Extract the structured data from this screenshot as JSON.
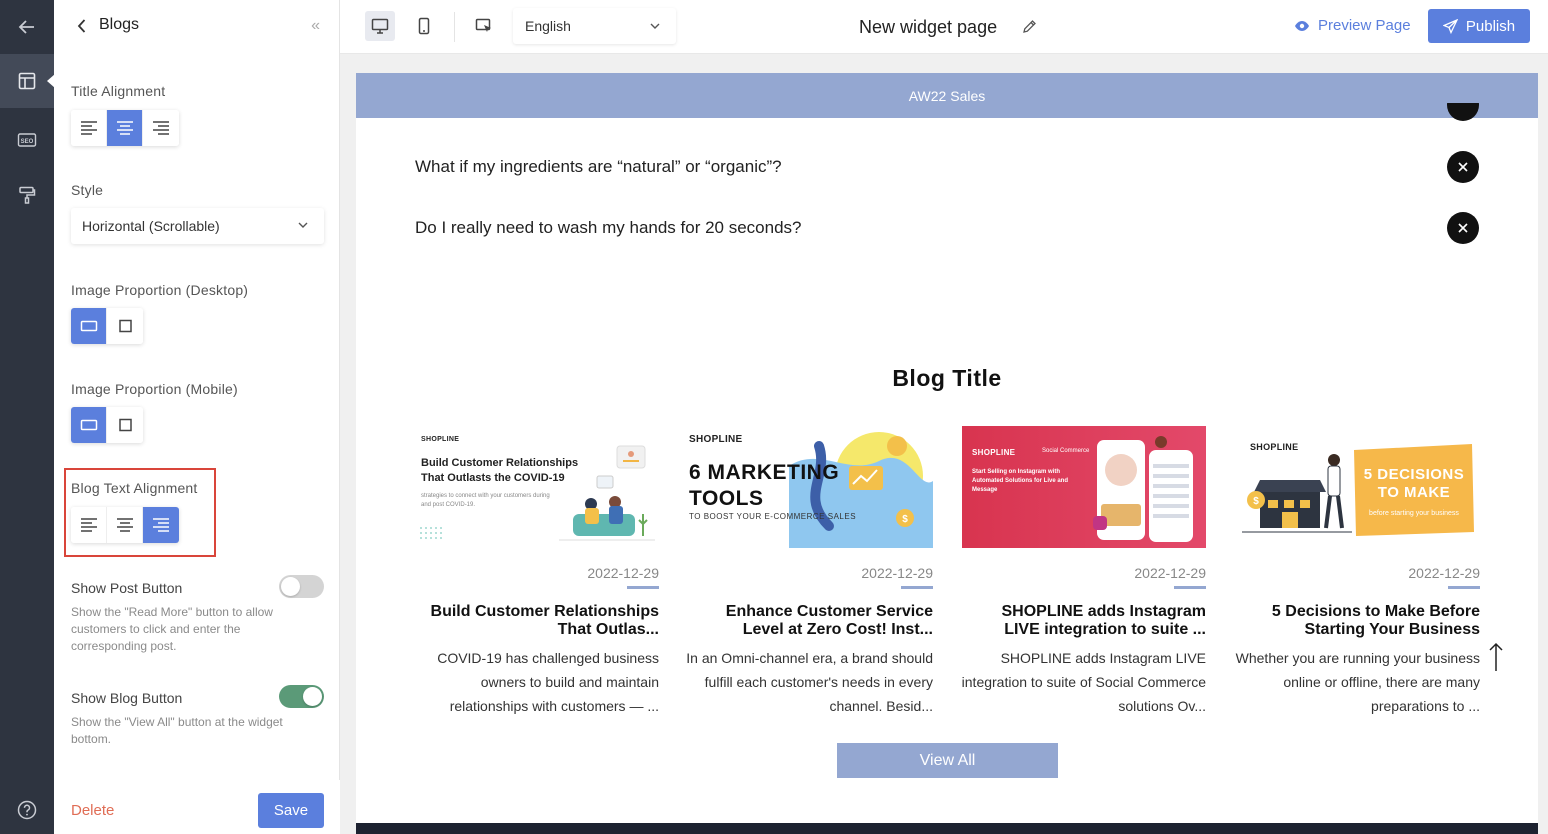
{
  "rail": {
    "items": [
      {
        "icon": "arrow-left-icon"
      },
      {
        "icon": "layout-icon"
      },
      {
        "icon": "seo-icon"
      },
      {
        "icon": "paint-roller-icon"
      }
    ],
    "help_icon": "help-circle-icon"
  },
  "panel": {
    "title": "Blogs",
    "collapse_glyph": "«",
    "title_alignment_label": "Title Alignment",
    "style_label": "Style",
    "style_value": "Horizontal (Scrollable)",
    "image_prop_desktop_label": "Image Proportion (Desktop)",
    "image_prop_mobile_label": "Image Proportion (Mobile)",
    "blog_text_alignment_label": "Blog Text Alignment",
    "show_post_button_label": "Show Post Button",
    "show_post_button_desc": "Show the \"Read More\" button to allow customers to click and enter the corresponding post.",
    "show_post_button_on": false,
    "show_blog_button_label": "Show Blog Button",
    "show_blog_button_desc": "Show the \"View All\" button at the widget bottom.",
    "show_blog_button_on": true,
    "delete_label": "Delete",
    "save_label": "Save"
  },
  "topbar": {
    "language": "English",
    "page_title": "New widget page",
    "preview_label": "Preview Page",
    "publish_label": "Publish"
  },
  "canvas": {
    "banner": "AW22 Sales",
    "faq": [
      "What if my ingredients are “natural” or “organic”?",
      "Do I really need to wash my hands for 20 seconds?"
    ],
    "blog_heading": "Blog Title",
    "view_all": "View All",
    "posts": [
      {
        "date": "2022-12-29",
        "title": "Build Customer Relationships That Outlas...",
        "body": "COVID-19 has challenged business owners to build and maintain relationships with customers — ...",
        "thumb_logo": "SHOPLINE",
        "thumb_heading": "Build Customer Relationships That Outlasts the COVID-19",
        "thumb_sub": "strategies to connect with your customers during and post COVID-19."
      },
      {
        "date": "2022-12-29",
        "title": "Enhance Customer Service Level at Zero Cost! Inst...",
        "body": "In an Omni-channel era, a brand should fulfill each customer's needs in every channel. Besid...",
        "thumb_logo": "SHOPLINE",
        "thumb_heading": "6 MARKETING TOOLS",
        "thumb_sub": "TO BOOST YOUR E-COMMERCE SALES"
      },
      {
        "date": "2022-12-29",
        "title": "SHOPLINE adds Instagram LIVE integration to suite ...",
        "body": "SHOPLINE adds Instagram LIVE integration to suite of Social Commerce solutions Ov...",
        "thumb_logo": "SHOPLINE",
        "thumb_heading": "Start Selling on Instagram with Automated Solutions for Live and Message",
        "thumb_sub": "Social Commerce"
      },
      {
        "date": "2022-12-29",
        "title": "5 Decisions to Make Before Starting Your Business",
        "body": "Whether you are running your business online or offline, there are many preparations to ...",
        "thumb_logo": "SHOPLINE",
        "thumb_heading": "5 DECISIONS TO MAKE",
        "thumb_sub": "before starting your business"
      }
    ]
  },
  "colors": {
    "accent": "#5b7fdd",
    "banner": "#94a7d1",
    "rail": "#2e3440",
    "danger": "#e06d55",
    "highlight": "#d9453a"
  }
}
